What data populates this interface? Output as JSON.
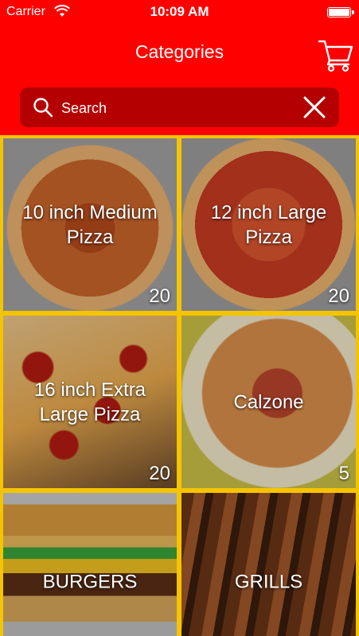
{
  "status_bar": {
    "carrier": "Carrier",
    "time": "10:09 AM",
    "wifi_icon": "wifi-icon",
    "battery_icon": "battery-icon"
  },
  "header": {
    "title": "Categories",
    "cart_icon": "cart-icon",
    "color": "#ff0000"
  },
  "search": {
    "placeholder": "Search",
    "value": "",
    "search_icon": "search-icon",
    "clear_icon": "close-icon",
    "box_color": "#b40000"
  },
  "categories": [
    {
      "name": "10 inch Medium Pizza",
      "count": "20"
    },
    {
      "name": "12 inch Large Pizza",
      "count": "20"
    },
    {
      "name": "16 inch Extra Large Pizza",
      "count": "20"
    },
    {
      "name": "Calzone",
      "count": "5"
    },
    {
      "name": "BURGERS",
      "count": ""
    },
    {
      "name": "GRILLS",
      "count": ""
    }
  ],
  "colors": {
    "grid_gap": "#f5c400",
    "text": "#ffffff"
  }
}
